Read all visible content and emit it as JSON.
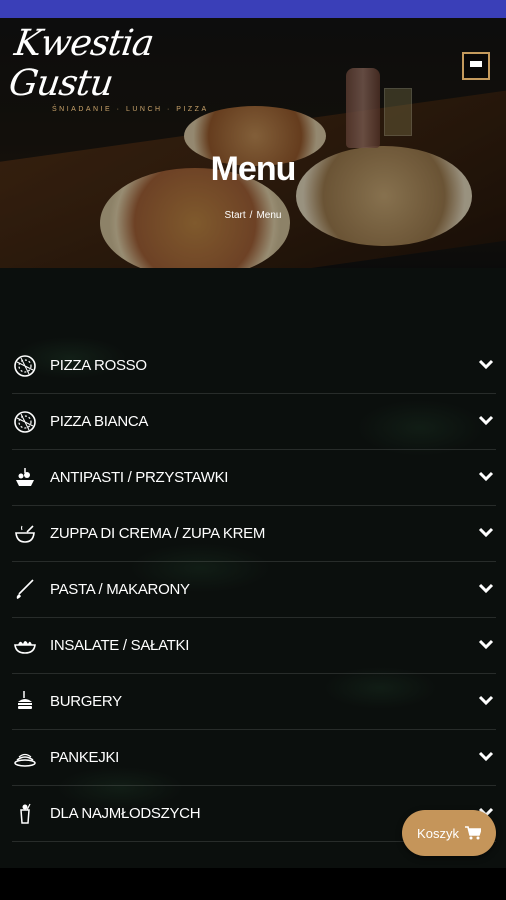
{
  "brand": {
    "name": "Kwestia Gustu",
    "tagline": "ŚNIADANIE · LUNCH · PIZZA"
  },
  "header": {
    "menu_icon": "hamburger-icon"
  },
  "hero": {
    "title": "Menu",
    "breadcrumb": {
      "home": "Start",
      "separator": "/",
      "current": "Menu"
    }
  },
  "categories": [
    {
      "label": "PIZZA ROSSO",
      "icon": "pizza-icon"
    },
    {
      "label": "PIZZA BIANCA",
      "icon": "pizza-icon"
    },
    {
      "label": "ANTIPASTI / PRZYSTAWKI",
      "icon": "appetizer-icon"
    },
    {
      "label": "ZUPPA DI CREMA / ZUPA KREM",
      "icon": "soup-icon"
    },
    {
      "label": "PASTA / MAKARONY",
      "icon": "pasta-icon"
    },
    {
      "label": "INSALATE / SAŁATKI",
      "icon": "salad-icon"
    },
    {
      "label": "BURGERY",
      "icon": "burger-icon"
    },
    {
      "label": "PANKEJKI",
      "icon": "pancake-icon"
    },
    {
      "label": "DLA NAJMŁODSZYCH",
      "icon": "kids-drink-icon"
    }
  ],
  "cart": {
    "label": "Koszyk",
    "icon": "cart-icon"
  },
  "colors": {
    "accent": "#c5955a",
    "statusbar": "#3a3fb8"
  }
}
